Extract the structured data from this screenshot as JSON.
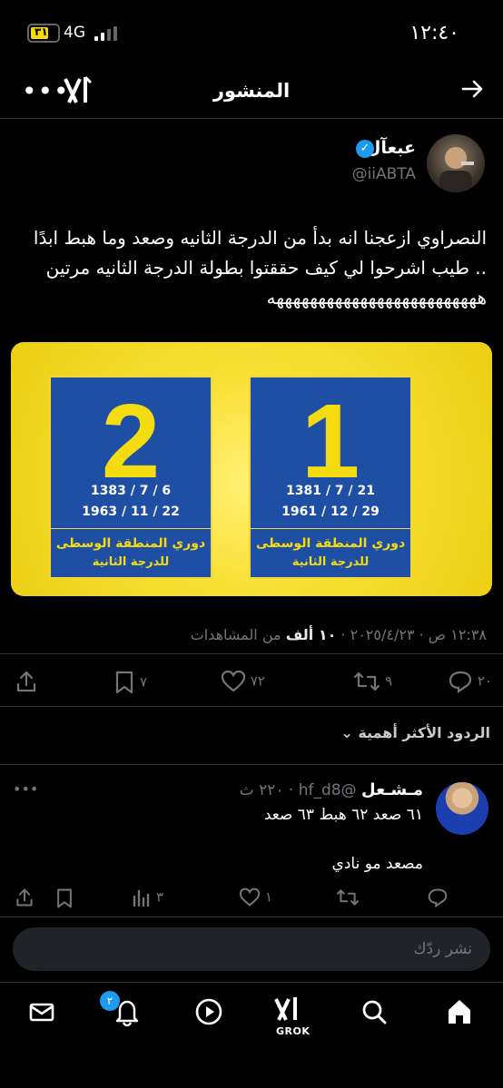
{
  "status_bar": {
    "time": "١٢:٤٠",
    "battery": "٣١",
    "network": "4G"
  },
  "header": {
    "title": "المنشور"
  },
  "post": {
    "author_name": "عبعآل",
    "handle": "@iiABTA",
    "text": "النصراوي ازعجنا انه بدأ من الدرجة الثانيه وصعد وما هبط ابدًا .. طيب اشرحوا لي كيف حققتوا بطولة الدرجة الثانيه مرتين هههههههههههههههههههههههههه",
    "media": {
      "cards": [
        {
          "number": "1",
          "hijri_date": "1381 / 7 / 21",
          "greg_date": "1961 / 12 / 29",
          "league_line1": "دوري المنطقة الوسطى",
          "league_line2": "للدرجة الثانية"
        },
        {
          "number": "2",
          "hijri_date": "1383 / 7 / 6",
          "greg_date": "1963 / 11 / 22",
          "league_line1": "دوري المنطقة الوسطى",
          "league_line2": "للدرجة الثانية"
        }
      ]
    },
    "timestamp": "١٢:٣٨ ص · ٢٠٢٥/٤/٢٣ ·",
    "views_count": "١٠ ألف",
    "views_label": "من المشاهدات",
    "actions": {
      "replies": "٢٠",
      "reposts": "٩",
      "likes": "٧٢",
      "bookmarks": "٧"
    }
  },
  "replies_sort": "الردود الأكثر أهمية",
  "reply": {
    "author_name": "مـشـعل",
    "handle": "@hf_d8",
    "time": "٢٢٠ ث",
    "line1": "٦١ صعد ٦٢ هبط ٦٣ صعد",
    "line2": "مصعد مو نادي",
    "actions": {
      "replies": "",
      "reposts": "",
      "likes": "١",
      "views": "٣"
    }
  },
  "compose": {
    "placeholder": "نشر ردّك"
  },
  "bottom_nav": {
    "notifications_badge": "٢",
    "grok_label": "GROK"
  },
  "colors": {
    "background": "#000000",
    "accent_blue": "#1d9bf0",
    "muted_text": "#71767b",
    "card_blue": "#1f4ea5",
    "card_yellow": "#f5dc10"
  }
}
